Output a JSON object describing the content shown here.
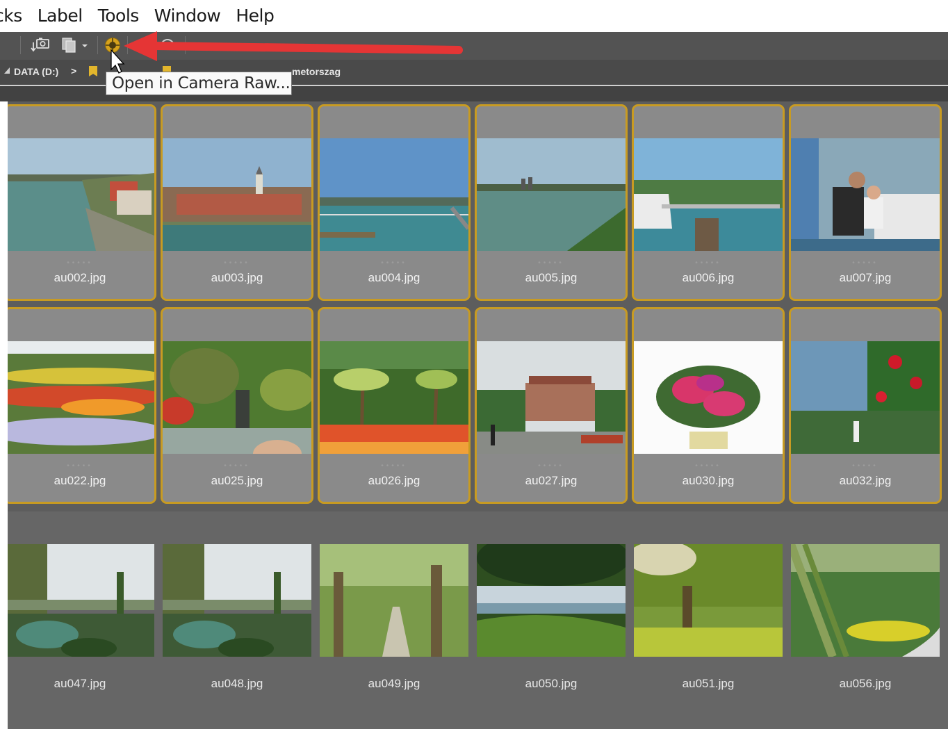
{
  "menu": [
    "cks",
    "Label",
    "Tools",
    "Window",
    "Help"
  ],
  "path": {
    "drive": "DATA (D:)",
    "separator": ">",
    "folder": "metorszag"
  },
  "tooltip": "Open in Camera Raw...",
  "accent_color": "#c89b22",
  "arrow_color": "#e53535",
  "toolbar_icons": [
    "get-photos-from-camera-icon",
    "copy-files-icon",
    "open-in-camera-raw-icon",
    "rotate-icon"
  ],
  "thumbnails": [
    {
      "name": "au002.jpg",
      "selected": true,
      "scene": "lake-town"
    },
    {
      "name": "au003.jpg",
      "selected": true,
      "scene": "town-church"
    },
    {
      "name": "au004.jpg",
      "selected": true,
      "scene": "harbor"
    },
    {
      "name": "au005.jpg",
      "selected": true,
      "scene": "lake-shore"
    },
    {
      "name": "au006.jpg",
      "selected": true,
      "scene": "ship-pier"
    },
    {
      "name": "au007.jpg",
      "selected": true,
      "scene": "people-boat"
    },
    {
      "name": "au022.jpg",
      "selected": true,
      "scene": "flower-beds"
    },
    {
      "name": "au025.jpg",
      "selected": true,
      "scene": "fountain-garden"
    },
    {
      "name": "au026.jpg",
      "selected": true,
      "scene": "palms"
    },
    {
      "name": "au027.jpg",
      "selected": true,
      "scene": "palace"
    },
    {
      "name": "au030.jpg",
      "selected": true,
      "scene": "flower-pot"
    },
    {
      "name": "au032.jpg",
      "selected": true,
      "scene": "roses"
    },
    {
      "name": "au047.jpg",
      "selected": false,
      "scene": "garden-lake"
    },
    {
      "name": "au048.jpg",
      "selected": false,
      "scene": "garden-lake"
    },
    {
      "name": "au049.jpg",
      "selected": false,
      "scene": "tree-alley"
    },
    {
      "name": "au050.jpg",
      "selected": false,
      "scene": "meadow-lake"
    },
    {
      "name": "au051.jpg",
      "selected": false,
      "scene": "park-lawn"
    },
    {
      "name": "au056.jpg",
      "selected": false,
      "scene": "tropical-path"
    }
  ]
}
